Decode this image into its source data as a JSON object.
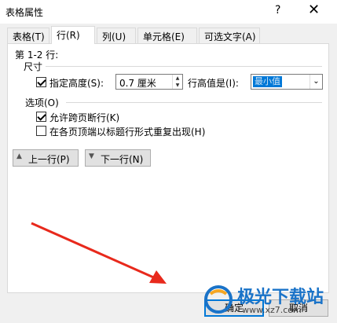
{
  "window": {
    "title": "表格属性",
    "help_glyph": "?",
    "close_glyph": "✕"
  },
  "tabs": [
    {
      "label": "表格(T)",
      "active": false
    },
    {
      "label": "行(R)",
      "active": true
    },
    {
      "label": "列(U)",
      "active": false
    },
    {
      "label": "单元格(E)",
      "active": false
    },
    {
      "label": "可选文字(A)",
      "active": false
    }
  ],
  "row_panel": {
    "rows_label": "第 1-2 行:",
    "size_section": "尺寸",
    "specify_height_label": "指定高度(S):",
    "specify_height_checked": true,
    "height_value": "0.7 厘米",
    "row_height_is_label": "行高值是(I):",
    "row_height_is_value": "最小值",
    "options_section": "选项(O)",
    "allow_break_label": "允许跨页断行(K)",
    "allow_break_checked": true,
    "repeat_header_label": "在各页顶端以标题行形式重复出现(H)",
    "repeat_header_checked": false,
    "prev_row_label": "上一行(P)",
    "next_row_label": "下一行(N)"
  },
  "footer": {
    "ok_label": "确定",
    "cancel_label": "取消"
  },
  "watermark": {
    "brand": "极光下载站",
    "url": "www.xz7.com"
  },
  "colors": {
    "accent": "#0078d7",
    "arrow": "#e8291c",
    "watermark": "#1a73c8"
  }
}
